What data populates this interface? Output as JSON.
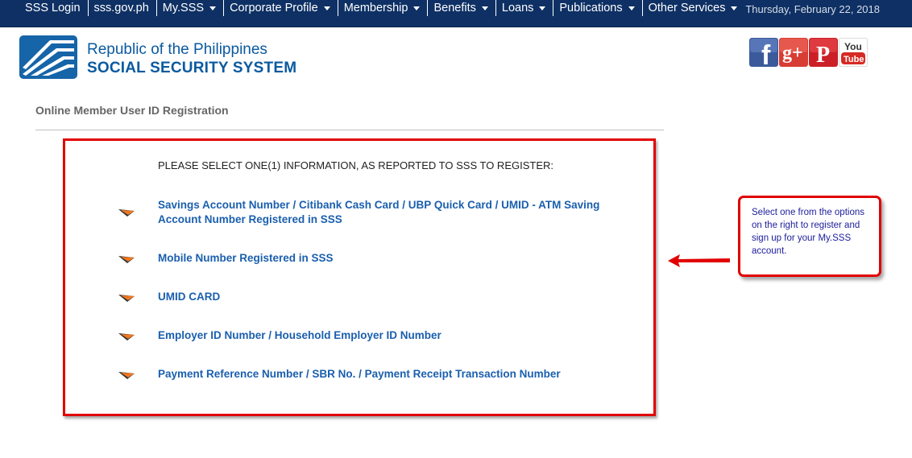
{
  "nav": {
    "items": [
      {
        "label": "SSS Login",
        "dropdown": false
      },
      {
        "label": "sss.gov.ph",
        "dropdown": false
      },
      {
        "label": "My.SSS",
        "dropdown": true
      },
      {
        "label": "Corporate Profile",
        "dropdown": true
      },
      {
        "label": "Membership",
        "dropdown": true
      },
      {
        "label": "Benefits",
        "dropdown": true
      },
      {
        "label": "Loans",
        "dropdown": true
      },
      {
        "label": "Publications",
        "dropdown": true
      },
      {
        "label": "Other Services",
        "dropdown": true
      }
    ],
    "date": "Thursday, February 22, 2018",
    "bg_color": "#0e3064"
  },
  "header": {
    "org_line1": "Republic of the Philippines",
    "org_line2": "SOCIAL SECURITY SYSTEM",
    "social": [
      {
        "name": "facebook-icon",
        "glyph": "f"
      },
      {
        "name": "google-plus-icon",
        "glyph": "g+"
      },
      {
        "name": "pinterest-icon",
        "glyph": "P"
      },
      {
        "name": "youtube-icon",
        "glyph_top": "You",
        "glyph_bottom": "Tube"
      }
    ]
  },
  "page": {
    "title": "Online Member User ID Registration",
    "instruction": "PLEASE SELECT ONE(1) INFORMATION, AS REPORTED TO SSS TO REGISTER:",
    "options": [
      "Savings Account Number / Citibank Cash Card / UBP Quick Card / UMID - ATM Saving Account Number Registered in SSS",
      "Mobile Number Registered in SSS",
      "UMID CARD",
      "Employer ID Number / Household Employer ID Number",
      "Payment Reference Number / SBR No. / Payment Receipt Transaction Number"
    ]
  },
  "callout": {
    "text": "Select one from the options on the right to register and sign up for your My.SSS account."
  },
  "colors": {
    "accent_red": "#e10000",
    "link_blue": "#1a5fae",
    "brand_blue": "#0a5aa0"
  }
}
